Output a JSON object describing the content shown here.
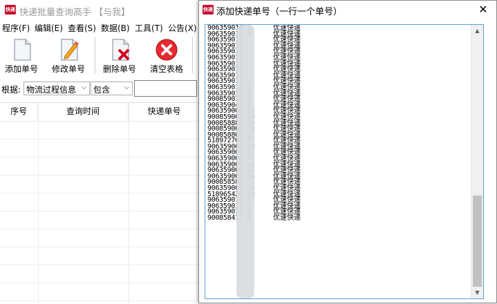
{
  "main_window": {
    "title": "快递批量查询高手 【与我】",
    "app_icon_text": "快递",
    "menus": [
      "程序(F)",
      "编辑(E)",
      "查看(S)",
      "数据(B)",
      "工具(T)",
      "公告(X)"
    ],
    "toolbar": {
      "add": "添加单号",
      "edit": "修改单号",
      "delete": "删除单号",
      "clear": "清空表格"
    },
    "filter": {
      "label": "根据:",
      "field": "物流过程信息",
      "op": "包含",
      "value": ""
    },
    "columns": [
      "序号",
      "查询时间",
      "快递单号"
    ]
  },
  "dialog": {
    "title": "添加快递单号（一行一个单号）",
    "close_symbol": "✕",
    "rows": [
      {
        "num": "906359012      3",
        "tag": "优速快递"
      },
      {
        "num": "906359012      4",
        "tag": "优速快递"
      },
      {
        "num": "906359012",
        "tag": "优速快递"
      },
      {
        "num": "906359012",
        "tag": "优速快递"
      },
      {
        "num": "906359012",
        "tag": "优速快递"
      },
      {
        "num": "906359012",
        "tag": "优速快递"
      },
      {
        "num": "906359012",
        "tag": "优速快递"
      },
      {
        "num": "906359012",
        "tag": "优速快递"
      },
      {
        "num": "906359012",
        "tag": "优速快递"
      },
      {
        "num": "906359012",
        "tag": "优速快递"
      },
      {
        "num": "906359012      1",
        "tag": "优速快递"
      },
      {
        "num": "906359019      3",
        "tag": "优速快递"
      },
      {
        "num": "900859033      6",
        "tag": "优速快递"
      },
      {
        "num": "906359041      9",
        "tag": "优速快递"
      },
      {
        "num": "906359000      98",
        "tag": "优速快递"
      },
      {
        "num": "900859000      30",
        "tag": "优速快递"
      },
      {
        "num": "900858880      39",
        "tag": "优速快递"
      },
      {
        "num": "900859000      78",
        "tag": "优速快递"
      },
      {
        "num": "900858860      21",
        "tag": "优速快递"
      },
      {
        "num": "518972700      57",
        "tag": "优速快递"
      },
      {
        "num": "906359000      49",
        "tag": "优速快递"
      },
      {
        "num": "906359000      52",
        "tag": "优速快递"
      },
      {
        "num": "906359000      72",
        "tag": "优速快递"
      },
      {
        "num": "906359000      94",
        "tag": "优速快递"
      },
      {
        "num": "906359000      95",
        "tag": "优速快递"
      },
      {
        "num": "906359000      96",
        "tag": "优速快递"
      },
      {
        "num": "900858580      72",
        "tag": "优速快递"
      },
      {
        "num": "906359000      16",
        "tag": "优速快递"
      },
      {
        "num": "518965420      30",
        "tag": "优速快递"
      },
      {
        "num": "906359010      5",
        "tag": "优速快递"
      },
      {
        "num": "906359012      1",
        "tag": "优速快递"
      },
      {
        "num": "906359012      8",
        "tag": "优速快递"
      },
      {
        "num": "900858411      5",
        "tag": "优速快递"
      }
    ]
  }
}
